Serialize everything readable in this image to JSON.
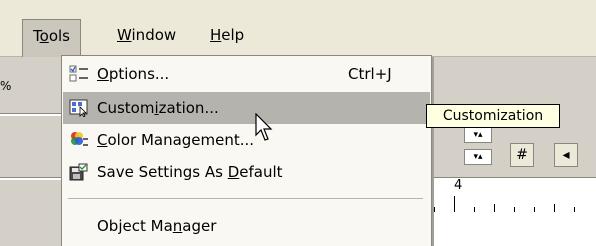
{
  "menubar": {
    "items": [
      {
        "pre": "T",
        "u": "o",
        "post": "ols"
      },
      {
        "pre": "",
        "u": "W",
        "post": "indow"
      },
      {
        "pre": "",
        "u": "H",
        "post": "elp"
      }
    ]
  },
  "background": {
    "zoom_fragment": "%",
    "ruler_number": "4"
  },
  "tools_menu": {
    "items": [
      {
        "label_pre": "",
        "label_u": "O",
        "label_post": "ptions...",
        "shortcut": "Ctrl+J",
        "icon": "options-icon"
      },
      {
        "label_pre": "Custom",
        "label_u": "i",
        "label_post": "zation...",
        "shortcut": "",
        "icon": "customization-icon",
        "highlighted": true
      },
      {
        "label_pre": "",
        "label_u": "C",
        "label_post": "olor Management...",
        "shortcut": "",
        "icon": "color-management-icon"
      },
      {
        "label_pre": "Save Settings As ",
        "label_u": "D",
        "label_post": "efault",
        "shortcut": "",
        "icon": "save-settings-icon"
      },
      {
        "label_pre": "Object Ma",
        "label_u": "n",
        "label_post": "ager",
        "shortcut": "",
        "icon": ""
      }
    ]
  },
  "tooltip": {
    "text": "Customization"
  },
  "colors": {
    "menubar_bg": "#ece9d8",
    "menu_bg": "#f9f8f3",
    "highlight_bg": "#b5b3ad",
    "tooltip_bg": "#ffffe1"
  }
}
